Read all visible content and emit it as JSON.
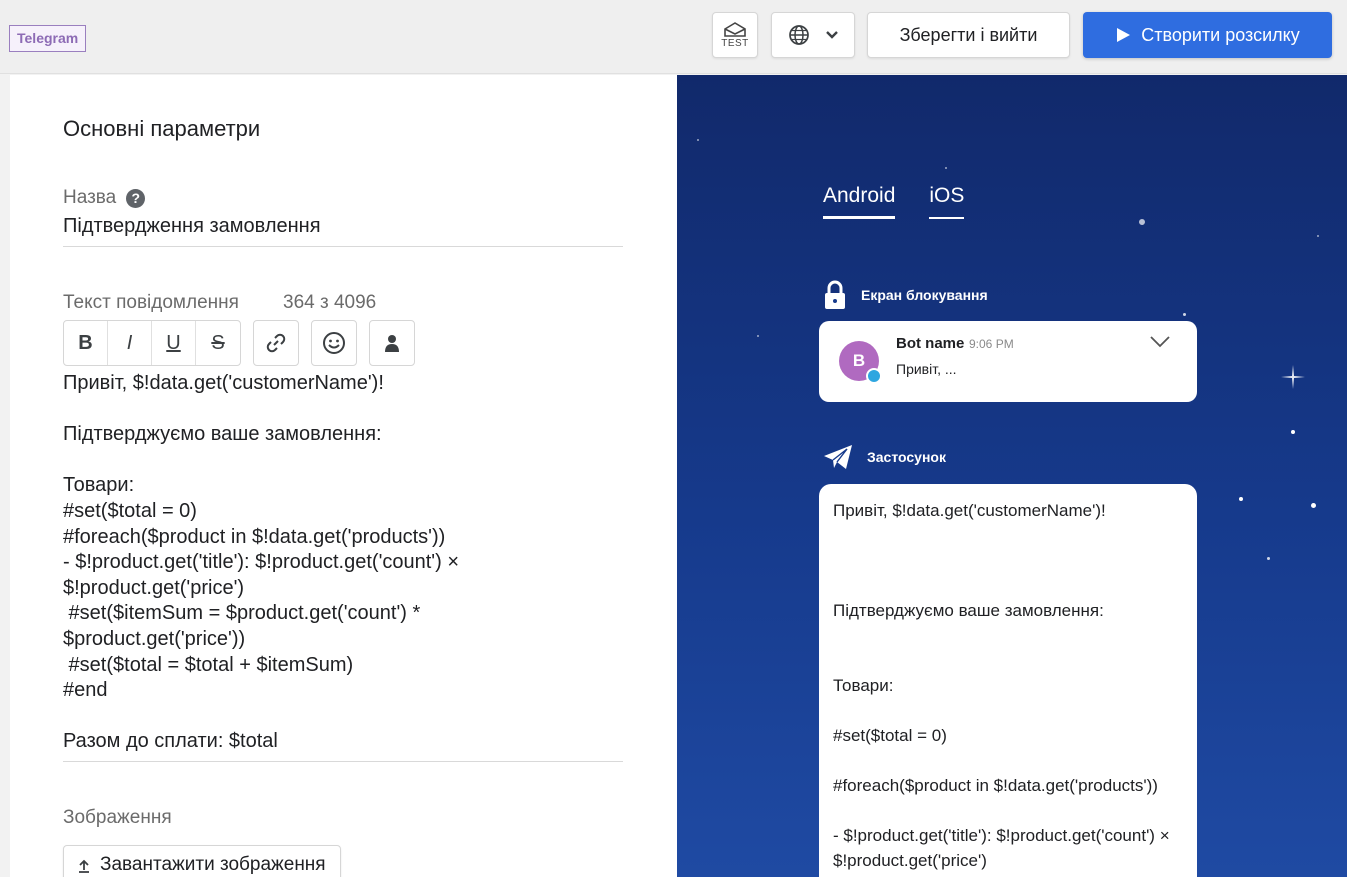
{
  "header": {
    "channel_badge": "Telegram",
    "test_label": "TEST",
    "save_exit": "Зберегти і вийти",
    "create_mailing": "Створити розсилку"
  },
  "form": {
    "section_title": "Основні параметри",
    "name_label": "Назва",
    "name_value": "Підтвердження замовлення",
    "text_label": "Текст повідомлення",
    "char_counter": "364 з 4096",
    "toolbar": {
      "bold": "B",
      "italic": "I",
      "underline": "U",
      "strike": "S"
    },
    "message_lines": [
      "Привіт, $!data.get('customerName')!",
      "",
      "Підтверджуємо ваше замовлення:",
      "",
      "Товари:",
      "#set($total = 0)",
      "#foreach($product in $!data.get('products'))",
      "- $!product.get('title'): $!product.get('count') ×",
      "$!product.get('price')",
      " #set($itemSum = $product.get('count') *",
      "$product.get('price'))",
      " #set($total = $total + $itemSum)",
      "#end",
      "",
      "Разом до сплати: $total"
    ],
    "image_label": "Зображення",
    "upload_button": "Завантажити зображення"
  },
  "preview": {
    "tabs": [
      "Android",
      "iOS"
    ],
    "active_tab": "Android",
    "lock_screen_label": "Екран блокування",
    "notification": {
      "avatar_letter": "B",
      "sender": "Bot name",
      "time": "9:06 PM",
      "text": "Привіт, ..."
    },
    "app_label": "Застосунок",
    "app_message_lines": [
      "Привіт, $!data.get('customerName')!",
      "Підтверджуємо ваше замовлення:",
      "Товари:",
      "#set($total = 0)",
      "#foreach($product in $!data.get('products'))",
      "- $!product.get('title'): $!product.get('count') ×",
      "$!product.get('price')"
    ]
  },
  "colors": {
    "primary": "#2f6de0",
    "telegram_badge": "#8d6bb5",
    "preview_bg": "#163a8c"
  }
}
